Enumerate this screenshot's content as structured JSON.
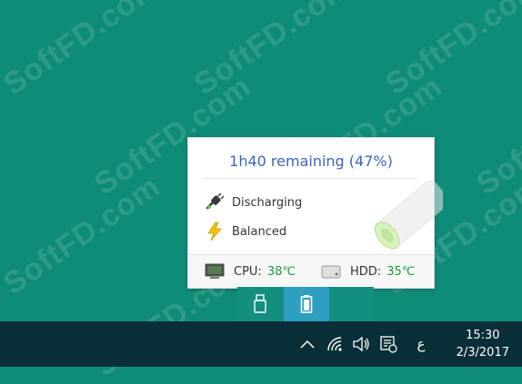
{
  "watermark": "SoftFD.com",
  "popup": {
    "title": "1h40 remaining (47%)",
    "status": "Discharging",
    "plan": "Balanced",
    "cpu": {
      "label": "CPU:",
      "value": "38℃"
    },
    "hdd": {
      "label": "HDD:",
      "value": "35℃"
    }
  },
  "taskbar": {
    "time": "15:30",
    "date": "2/3/2017",
    "lang": "ع"
  },
  "colors": {
    "desktop": "#0f8c78",
    "title": "#3a63c6",
    "temp": "#1a9a3a",
    "taskbar": "#0b2f38"
  }
}
